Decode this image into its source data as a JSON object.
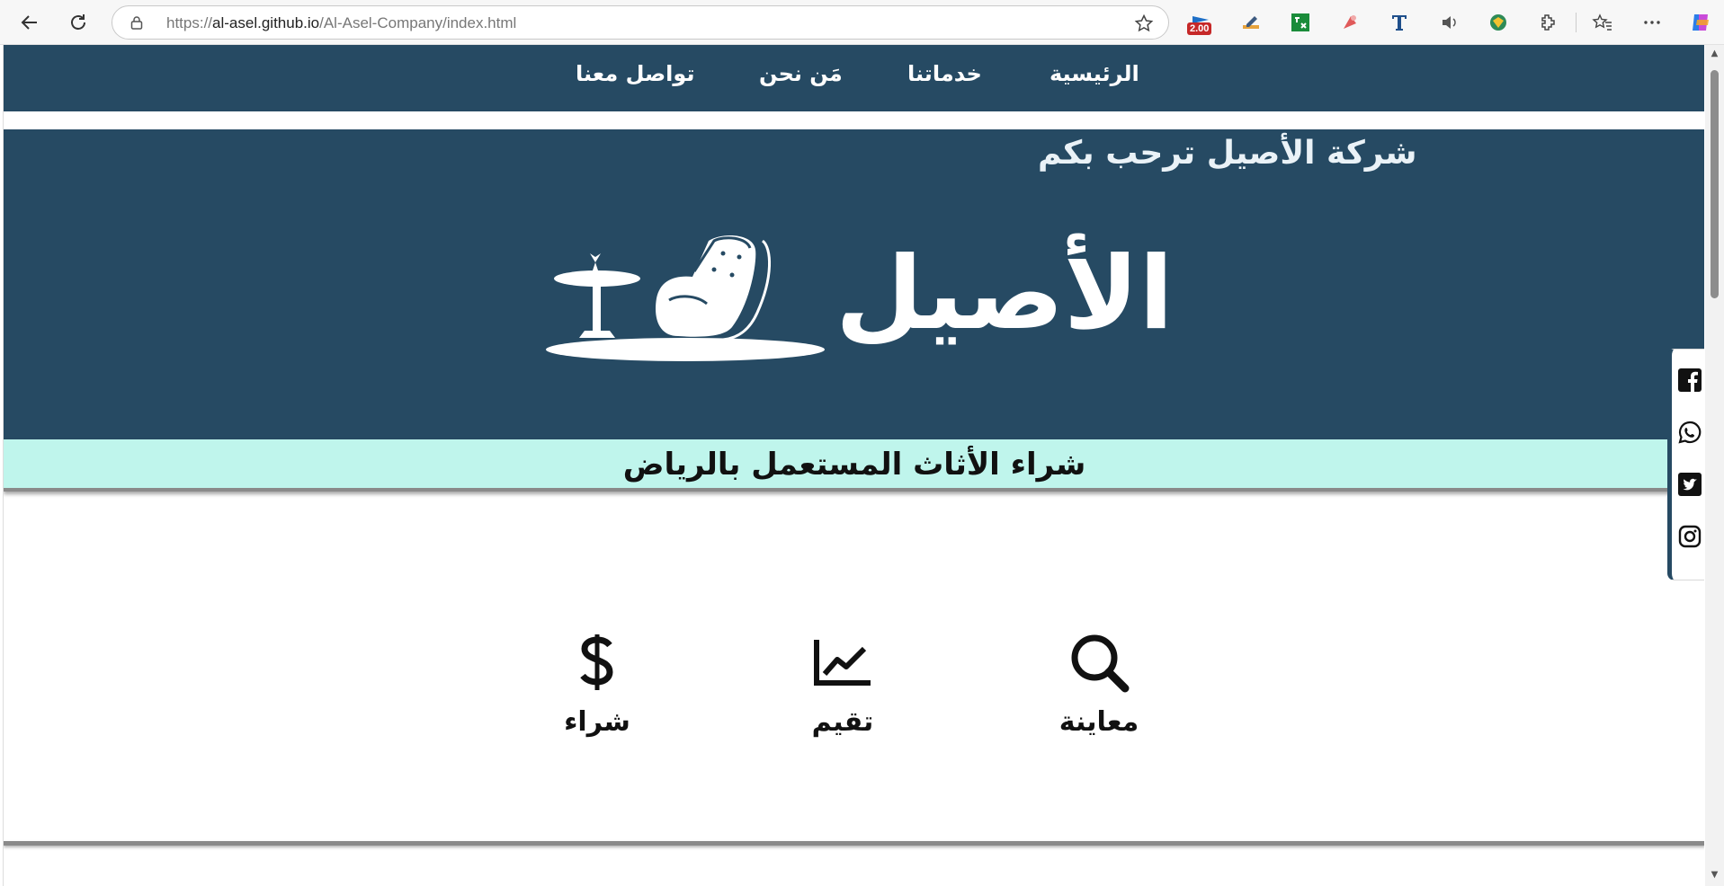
{
  "browser": {
    "url_prefix": "https://",
    "url_host": "al-asel.github.io",
    "url_path": "/Al-Asel-Company/index.html",
    "extension_badge": "2.00",
    "icons": [
      "back-icon",
      "reload-icon",
      "lock-icon",
      "star-icon",
      "extension-icon",
      "favorites-icon",
      "more-icon",
      "copilot-icon"
    ]
  },
  "site": {
    "nav": {
      "home": "الرئيسية",
      "services": "خدماتنا",
      "about": "مَن نحن",
      "contact": "تواصل معنا"
    },
    "hero": {
      "welcome": "شركة الأصيل ترحب بكم",
      "logo_text": "الأصيل"
    },
    "tagline": "شراء الأثاث المستعمل بالرياض",
    "services": {
      "inspect": "معاينة",
      "evaluate": "تقيم",
      "buy": "شراء"
    },
    "social": [
      "facebook-icon",
      "whatsapp-icon",
      "twitter-icon",
      "instagram-icon"
    ],
    "colors": {
      "primary": "#264a63",
      "band": "#bff5ec",
      "text": "#111111"
    }
  }
}
